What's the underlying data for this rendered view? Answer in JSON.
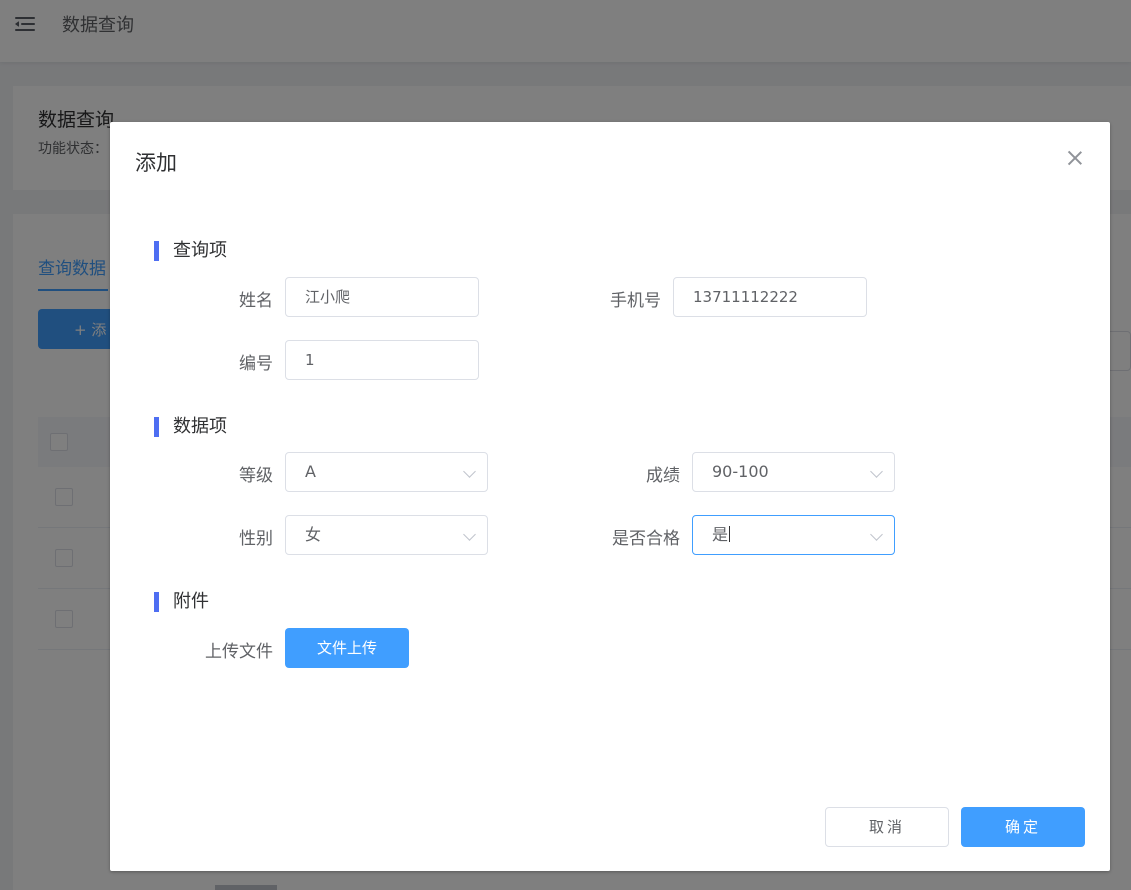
{
  "topbar": {
    "title": "数据查询",
    "menu_icon": "menu-fold-icon"
  },
  "header_card": {
    "title": "数据查询",
    "status_label": "功能状态："
  },
  "main_card": {
    "tab_label": "查询数据",
    "add_button_label": "+ 添"
  },
  "dialog": {
    "title": "添加",
    "close_icon": "close-icon",
    "sections": {
      "query": "查询项",
      "data": "数据项",
      "attachment": "附件"
    },
    "fields": {
      "name": {
        "label": "姓名",
        "value": "江小爬"
      },
      "phone": {
        "label": "手机号",
        "value": "13711112222"
      },
      "number": {
        "label": "编号",
        "value": "1"
      },
      "grade": {
        "label": "等级",
        "value": "A"
      },
      "score": {
        "label": "成绩",
        "value": "90-100"
      },
      "gender": {
        "label": "性别",
        "value": "女"
      },
      "qualified": {
        "label": "是否合格",
        "value": "是"
      },
      "upload": {
        "label": "上传文件",
        "button": "文件上传"
      }
    },
    "footer": {
      "cancel": "取消",
      "confirm": "确定"
    }
  },
  "colors": {
    "primary": "#409eff",
    "section_bar": "#4e6ef2",
    "overlay": "rgba(0,0,0,0.5)"
  }
}
